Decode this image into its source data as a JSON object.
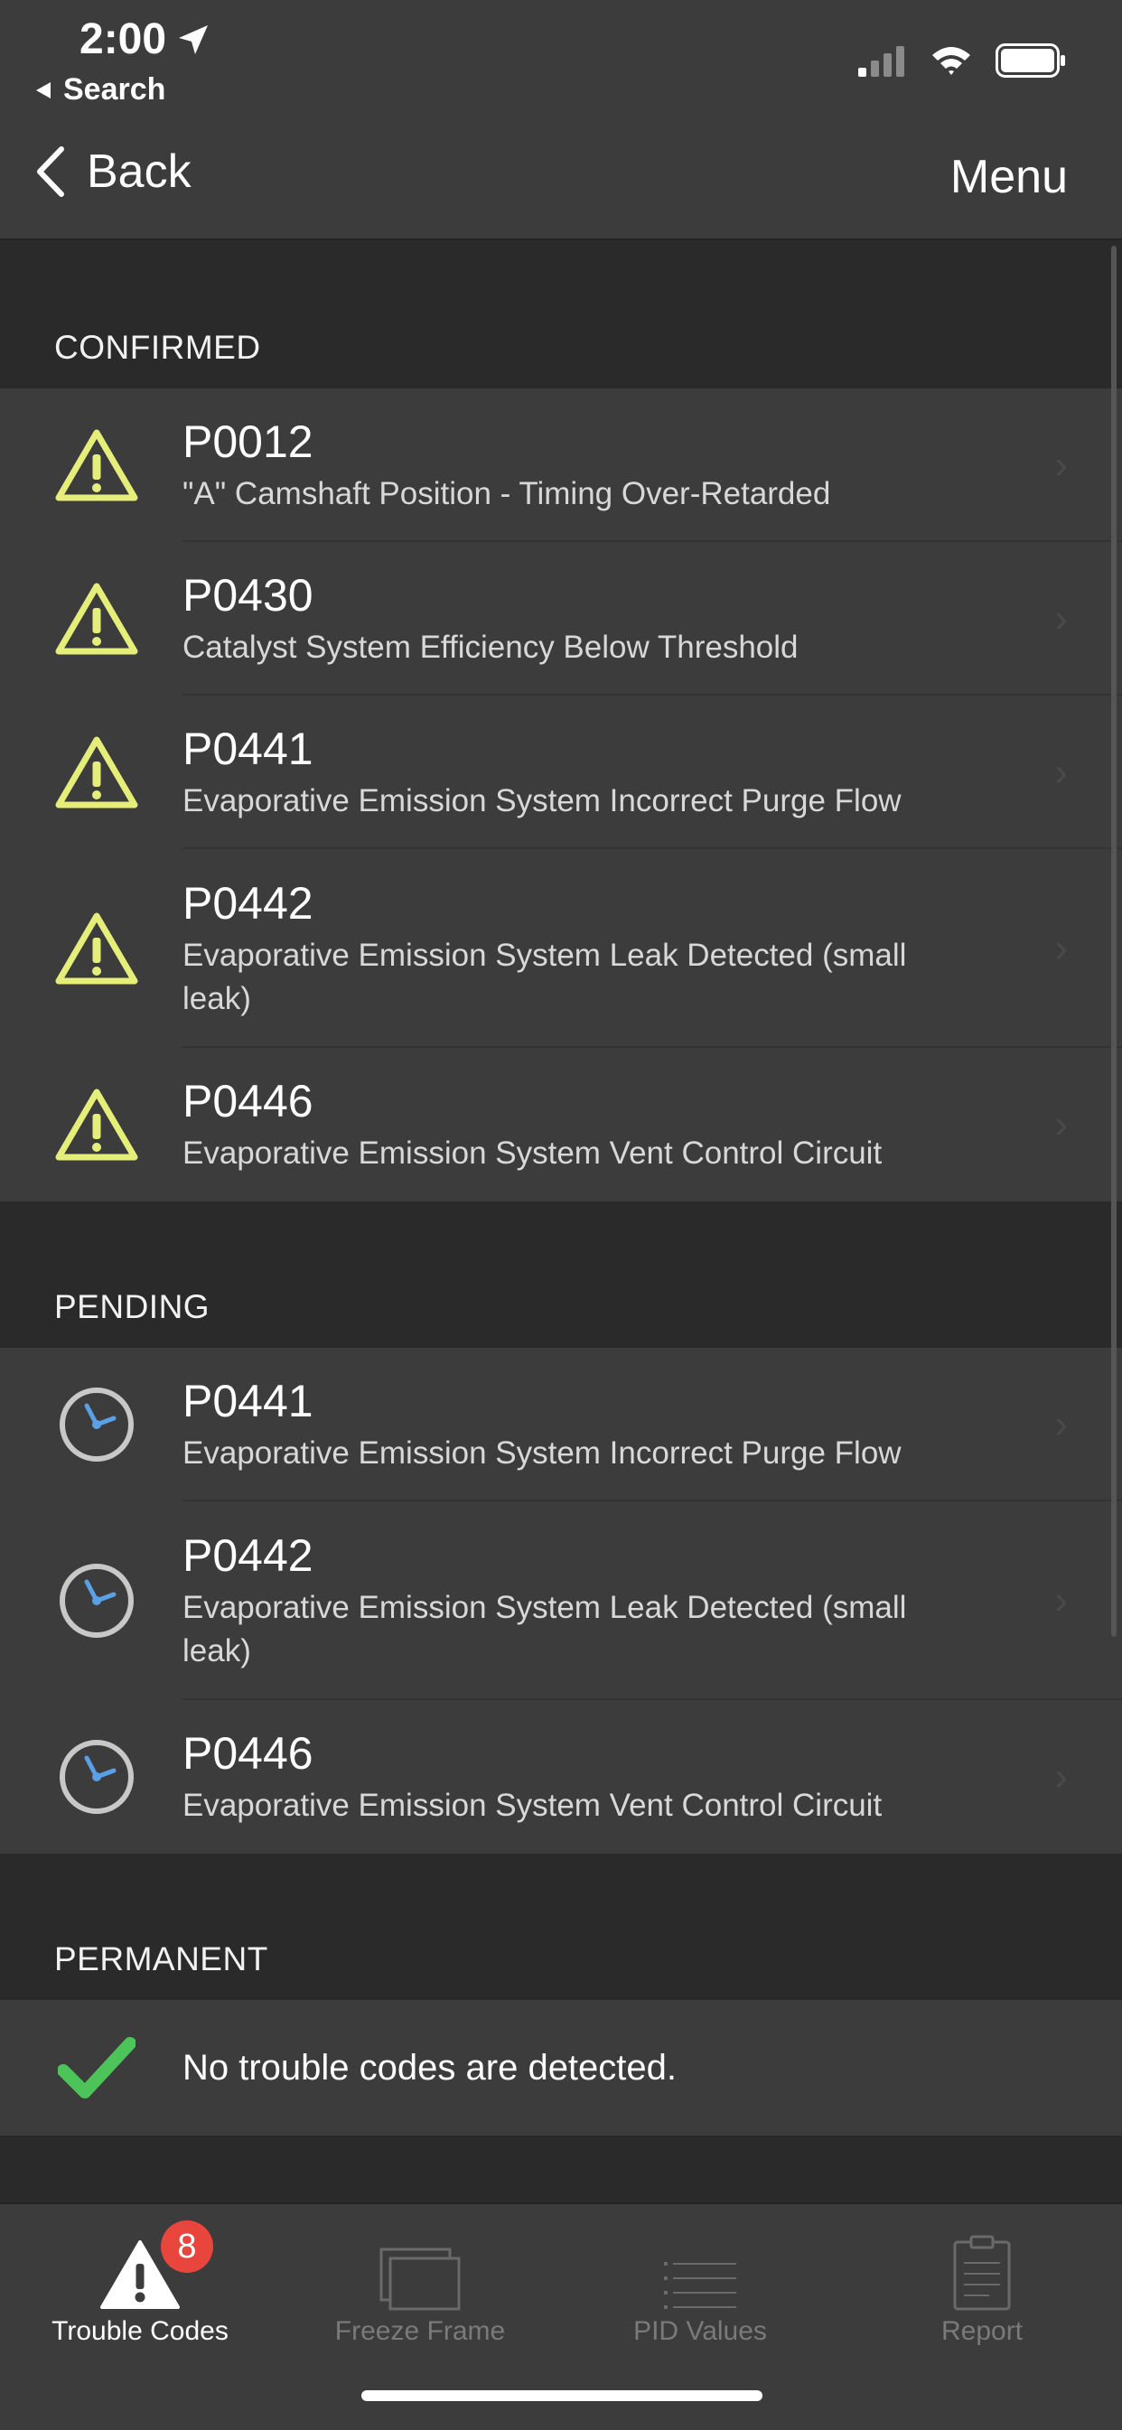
{
  "status_bar": {
    "time": "2:00",
    "back_app": "Search"
  },
  "nav": {
    "back_label": "Back",
    "menu_label": "Menu"
  },
  "sections": {
    "confirmed": {
      "title": "CONFIRMED",
      "items": [
        {
          "code": "P0012",
          "desc": "\"A\" Camshaft Position - Timing Over-Retarded"
        },
        {
          "code": "P0430",
          "desc": "Catalyst System Efficiency Below Threshold"
        },
        {
          "code": "P0441",
          "desc": "Evaporative Emission System Incorrect Purge Flow"
        },
        {
          "code": "P0442",
          "desc": "Evaporative Emission System Leak Detected (small leak)"
        },
        {
          "code": "P0446",
          "desc": "Evaporative Emission System Vent Control Circuit"
        }
      ]
    },
    "pending": {
      "title": "PENDING",
      "items": [
        {
          "code": "P0441",
          "desc": "Evaporative Emission System Incorrect Purge Flow"
        },
        {
          "code": "P0442",
          "desc": "Evaporative Emission System Leak Detected (small leak)"
        },
        {
          "code": "P0446",
          "desc": "Evaporative Emission System Vent Control Circuit"
        }
      ]
    },
    "permanent": {
      "title": "PERMANENT",
      "empty_message": "No trouble codes are detected."
    }
  },
  "tabbar": {
    "tabs": [
      {
        "label": "Trouble Codes",
        "icon": "warning-icon",
        "active": true,
        "badge": "8"
      },
      {
        "label": "Freeze Frame",
        "icon": "freeze-frame-icon",
        "active": false
      },
      {
        "label": "PID Values",
        "icon": "list-icon",
        "active": false
      },
      {
        "label": "Report",
        "icon": "clipboard-icon",
        "active": false
      }
    ]
  },
  "colors": {
    "background": "#2a2a2a",
    "cell": "#3c3c3c",
    "warning_yellow": "#e6ee7a",
    "clock_blue": "#5aa0e6",
    "check_green": "#4cc45a",
    "badge_red": "#e8463c"
  }
}
